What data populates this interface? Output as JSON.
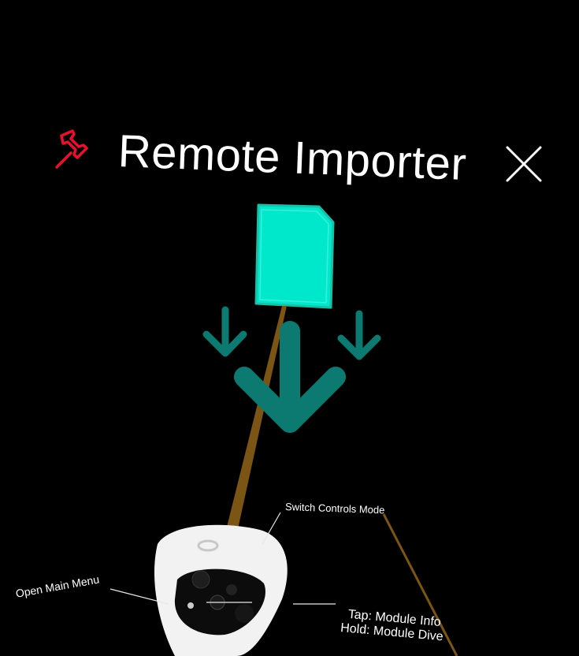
{
  "window": {
    "title": "Remote Importer"
  },
  "icons": {
    "pin": "pushpin-icon",
    "close": "close-icon",
    "document": "document-icon",
    "download_arrows": "arrow-down-icon"
  },
  "controller_hints": {
    "switch_mode": "Switch Controls Mode",
    "main_menu": "Open Main Menu",
    "module_tap": "Tap: Module Info",
    "module_hold": "Hold: Module Dive"
  },
  "colors": {
    "background": "#000000",
    "pin": "#e8112d",
    "accent": "#00e8cc",
    "arrow": "#0c7a70",
    "laser": "#7a5514",
    "controller": "#f2f2f2"
  }
}
